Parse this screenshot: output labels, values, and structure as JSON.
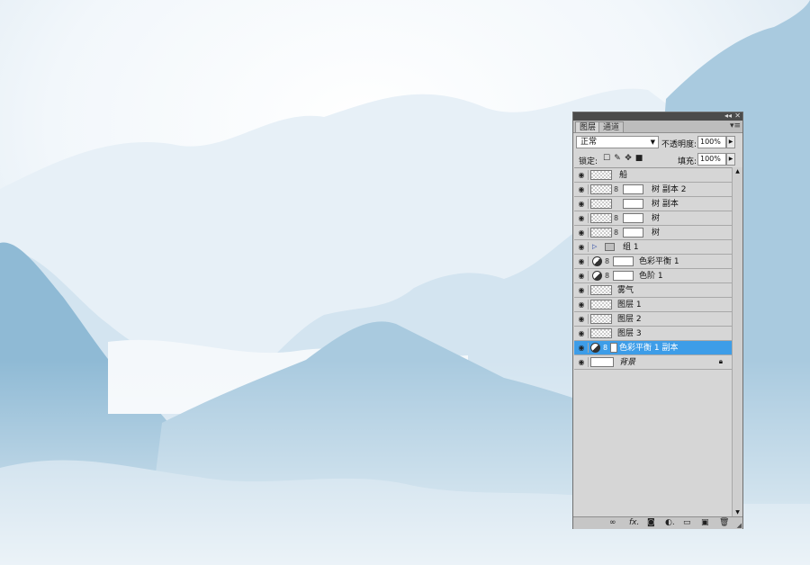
{
  "canvas": {
    "sky_color": "#ffffff",
    "mountain_light": "#d3e4f0",
    "mountain_mid": "#a9cadf",
    "mountain_dark": "#8fbad5"
  },
  "panel": {
    "window_controls": [
      "◂◂",
      "✕"
    ],
    "tabs": [
      {
        "label": "图层",
        "active": true
      },
      {
        "label": "通道",
        "active": false
      }
    ],
    "menu_icon": "▾≡",
    "blend_mode": "正常",
    "opacity_label": "不透明度:",
    "opacity_value": "100%",
    "lock_label": "锁定:",
    "lock_icons": [
      "lock-transparent-icon",
      "lock-paint-icon",
      "lock-move-icon",
      "lock-all-icon"
    ],
    "fill_label": "填充:",
    "fill_value": "100%",
    "selection_color": "#3d9de8",
    "layers": [
      {
        "name": "船"
      },
      {
        "name": "树 副本 2"
      },
      {
        "name": "树 副本"
      },
      {
        "name": "树"
      },
      {
        "name": "树"
      },
      {
        "name": "组 1"
      },
      {
        "name": "色彩平衡 1"
      },
      {
        "name": "色阶 1"
      },
      {
        "name": "雾气"
      },
      {
        "name": "图层 1"
      },
      {
        "name": "图层 2"
      },
      {
        "name": "图层 3"
      },
      {
        "name": "色彩平衡 1 副本",
        "selected": true
      },
      {
        "name": "背景"
      }
    ],
    "bottom_icons": [
      "link-icon",
      "fx-icon",
      "mask-icon",
      "adjustment-icon",
      "group-icon",
      "new-layer-icon",
      "trash-icon"
    ]
  }
}
